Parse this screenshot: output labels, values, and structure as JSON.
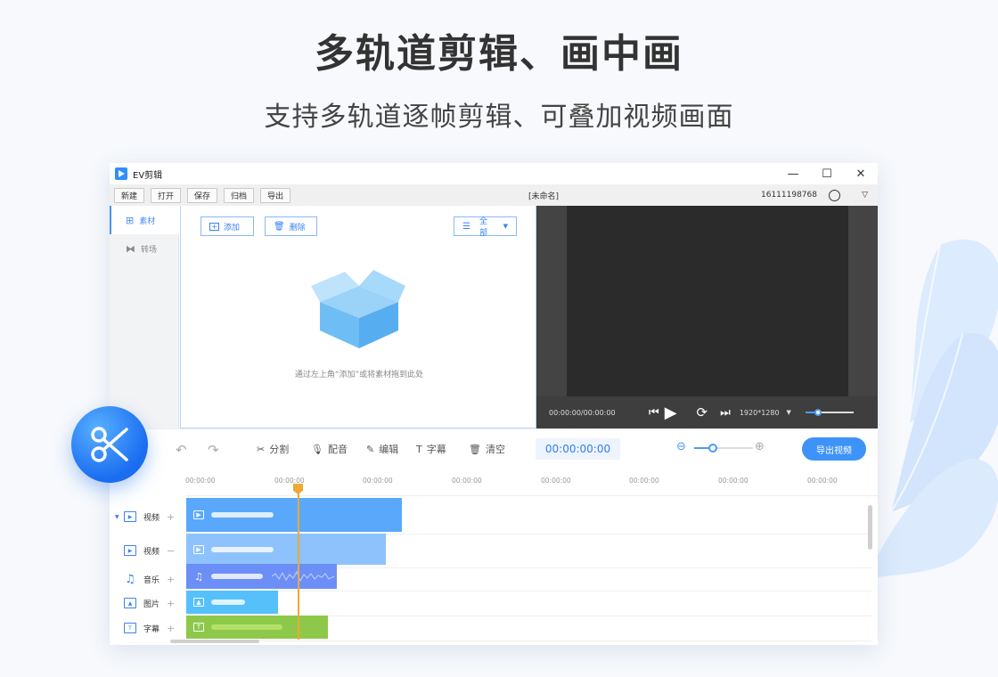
{
  "headline": "多轨道剪辑、画中画",
  "subheadline": "支持多轨道逐帧剪辑、可叠加视频画面",
  "colors": {
    "accent": "#3d93f7",
    "primary_blue": "#2f8ffb",
    "video_clip": "#5aa8fb",
    "audio_clip": "#6b8ff7",
    "image_clip": "#55c0fa",
    "subtitle_clip": "#8dc84a",
    "playhead": "#f0a832"
  },
  "window": {
    "app_name": "EV剪辑",
    "minimize": "—",
    "maximize": "☐",
    "close": "✕"
  },
  "menubar": {
    "buttons": [
      "新建",
      "打开",
      "保存",
      "归档",
      "导出"
    ],
    "doc_title": "[未命名]",
    "user_id": "16111198768"
  },
  "sidebar": {
    "items": [
      {
        "label": "素材",
        "icon": "grid-icon",
        "active": true
      },
      {
        "label": "转场",
        "icon": "transition-icon",
        "active": false
      }
    ]
  },
  "media": {
    "add_label": "添加",
    "delete_label": "删除",
    "filter_label": "全部",
    "empty_hint": "通过左上角“添加”或将素材拖到此处"
  },
  "preview": {
    "time": "00:00:00/00:00:00",
    "resolution": "1920*1280",
    "volume": 0.25
  },
  "edit_toolbar": {
    "split": "分割",
    "dub": "配音",
    "edit": "编辑",
    "subtitle": "字幕",
    "clear": "清空",
    "current_time": "00:00:00:00",
    "export": "导出视频",
    "zoom": 0.3
  },
  "timeline": {
    "ticks": [
      "00:00:00",
      "00:00:00",
      "00:00:00",
      "00:00:00",
      "00:00:00",
      "00:00:00",
      "00:00:00",
      "00:00:00"
    ],
    "tracks": [
      {
        "label": "视频",
        "type": "video",
        "action": "+"
      },
      {
        "label": "视频",
        "type": "video",
        "action": "−"
      },
      {
        "label": "音乐",
        "type": "music",
        "action": "+"
      },
      {
        "label": "图片",
        "type": "image",
        "action": "+"
      },
      {
        "label": "字幕",
        "type": "subtitle",
        "action": "+"
      }
    ]
  }
}
